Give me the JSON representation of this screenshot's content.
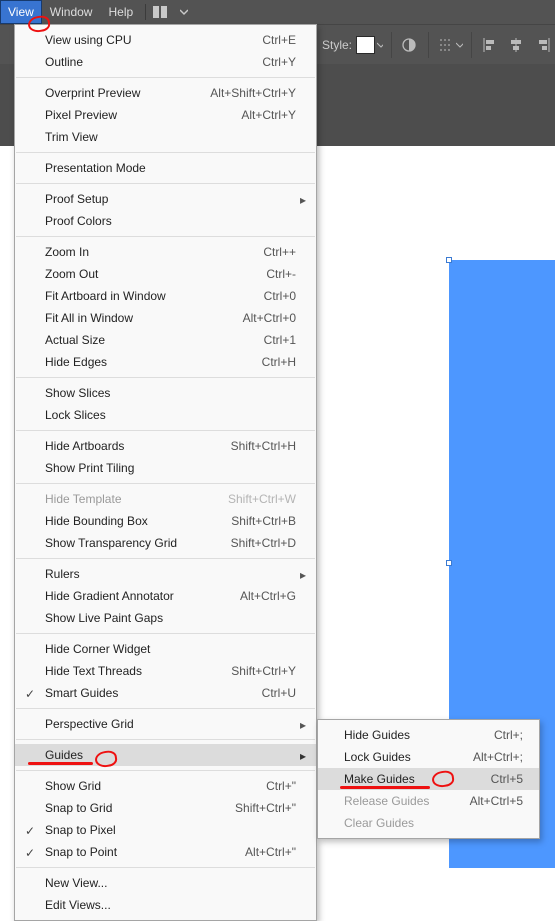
{
  "menubar": {
    "view": "View",
    "window": "Window",
    "help": "Help"
  },
  "optionsbar": {
    "style_label": "Style:"
  },
  "view_menu": {
    "view_cpu": "View using CPU",
    "view_cpu_sc": "Ctrl+E",
    "outline": "Outline",
    "outline_sc": "Ctrl+Y",
    "overprint": "Overprint Preview",
    "overprint_sc": "Alt+Shift+Ctrl+Y",
    "pixel": "Pixel Preview",
    "pixel_sc": "Alt+Ctrl+Y",
    "trim": "Trim View",
    "presentation": "Presentation Mode",
    "proof_setup": "Proof Setup",
    "proof_colors": "Proof Colors",
    "zoom_in": "Zoom In",
    "zoom_in_sc": "Ctrl++",
    "zoom_out": "Zoom Out",
    "zoom_out_sc": "Ctrl+-",
    "fit_artboard": "Fit Artboard in Window",
    "fit_artboard_sc": "Ctrl+0",
    "fit_all": "Fit All in Window",
    "fit_all_sc": "Alt+Ctrl+0",
    "actual": "Actual Size",
    "actual_sc": "Ctrl+1",
    "hide_edges": "Hide Edges",
    "hide_edges_sc": "Ctrl+H",
    "show_slices": "Show Slices",
    "lock_slices": "Lock Slices",
    "hide_artboards": "Hide Artboards",
    "hide_artboards_sc": "Shift+Ctrl+H",
    "show_print_tiling": "Show Print Tiling",
    "hide_template": "Hide Template",
    "hide_template_sc": "Shift+Ctrl+W",
    "hide_bbox": "Hide Bounding Box",
    "hide_bbox_sc": "Shift+Ctrl+B",
    "show_trans_grid": "Show Transparency Grid",
    "show_trans_grid_sc": "Shift+Ctrl+D",
    "rulers": "Rulers",
    "hide_grad": "Hide Gradient Annotator",
    "hide_grad_sc": "Alt+Ctrl+G",
    "live_paint": "Show Live Paint Gaps",
    "corner_widget": "Hide Corner Widget",
    "text_threads": "Hide Text Threads",
    "text_threads_sc": "Shift+Ctrl+Y",
    "smart_guides": "Smart Guides",
    "smart_guides_sc": "Ctrl+U",
    "persp": "Perspective Grid",
    "guides": "Guides",
    "show_grid": "Show Grid",
    "show_grid_sc": "Ctrl+\"",
    "snap_grid": "Snap to Grid",
    "snap_grid_sc": "Shift+Ctrl+\"",
    "snap_pixel": "Snap to Pixel",
    "snap_point": "Snap to Point",
    "snap_point_sc": "Alt+Ctrl+\"",
    "new_view": "New View...",
    "edit_views": "Edit Views..."
  },
  "guides_sub": {
    "hide": "Hide Guides",
    "hide_sc": "Ctrl+;",
    "lock": "Lock Guides",
    "lock_sc": "Alt+Ctrl+;",
    "make": "Make Guides",
    "make_sc": "Ctrl+5",
    "release": "Release Guides",
    "release_sc": "Alt+Ctrl+5",
    "clear": "Clear Guides"
  },
  "annotations": {
    "view": "Annotation pointing to View menu",
    "guides": "Annotation underlining Guides row",
    "make": "Annotation underlining Make Guides row"
  }
}
